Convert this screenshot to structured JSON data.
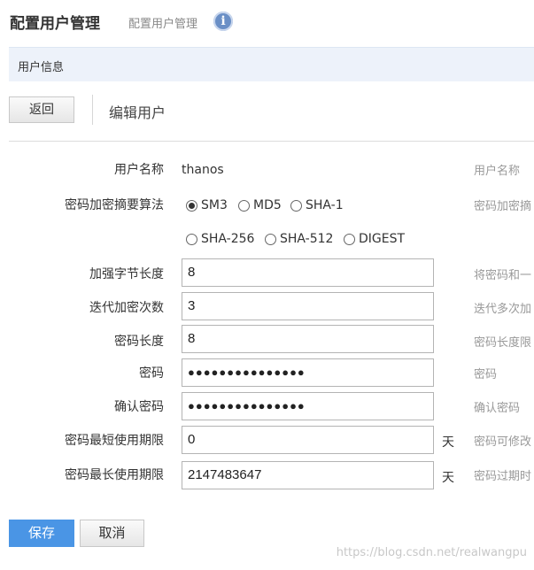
{
  "header": {
    "title": "配置用户管理",
    "subtitle": "配置用户管理",
    "info_icon_glyph": "i"
  },
  "info_bar": {
    "label": "用户信息"
  },
  "toolbar": {
    "back_label": "返回",
    "section_title": "编辑用户"
  },
  "form": {
    "username": {
      "label": "用户名称",
      "value": "thanos",
      "hint": "用户名称"
    },
    "algorithm": {
      "label": "密码加密摘要算法",
      "hint": "密码加密摘",
      "selected": "SM3",
      "options": [
        "SM3",
        "MD5",
        "SHA-1",
        "SHA-256",
        "SHA-512",
        "DIGEST"
      ]
    },
    "salt_length": {
      "label": "加强字节长度",
      "value": "8",
      "hint": "将密码和一"
    },
    "iterations": {
      "label": "迭代加密次数",
      "value": "3",
      "hint": "迭代多次加"
    },
    "password_length": {
      "label": "密码长度",
      "value": "8",
      "hint": "密码长度限"
    },
    "password": {
      "label": "密码",
      "value": "●●●●●●●●●●●●●●●",
      "hint": "密码"
    },
    "confirm_password": {
      "label": "确认密码",
      "value": "●●●●●●●●●●●●●●●",
      "hint": "确认密码"
    },
    "min_age": {
      "label": "密码最短使用期限",
      "value": "0",
      "unit": "天",
      "hint": "密码可修改"
    },
    "max_age": {
      "label": "密码最长使用期限",
      "value": "2147483647",
      "unit": "天",
      "hint": "密码过期时"
    }
  },
  "actions": {
    "save_label": "保存",
    "cancel_label": "取消"
  },
  "watermark": "https://blog.csdn.net/realwangpu",
  "colors": {
    "primary": "#4a95e5",
    "info_bar_bg": "#edf2fa",
    "info_icon": "#6a8fc6"
  }
}
